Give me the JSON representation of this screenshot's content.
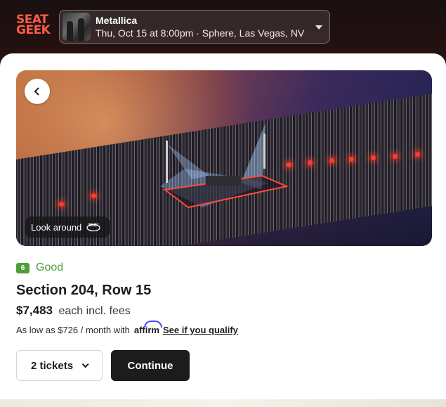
{
  "header": {
    "logo_line1": "SEAT",
    "logo_line2": "GEEK",
    "event_title": "Metallica",
    "event_subtitle": "Thu, Oct 15 at 8:00pm · Sphere, Las Vegas, NV"
  },
  "hero": {
    "look_around_label": "Look around",
    "badge_360": "360°"
  },
  "listing": {
    "deal_score": "6",
    "deal_label": "Good",
    "section_row": "Section 204, Row 15",
    "price": "$7,483",
    "price_note": "each incl. fees",
    "affirm_text": "As low as $726 / month with",
    "affirm_brand": "affirm",
    "affirm_link": "See if you qualify"
  },
  "actions": {
    "tickets_label": "2 tickets",
    "continue_label": "Continue"
  },
  "colors": {
    "brand": "#ff5b49",
    "deal_good": "#4d9e3a",
    "primary_button": "#1c1c1c"
  }
}
